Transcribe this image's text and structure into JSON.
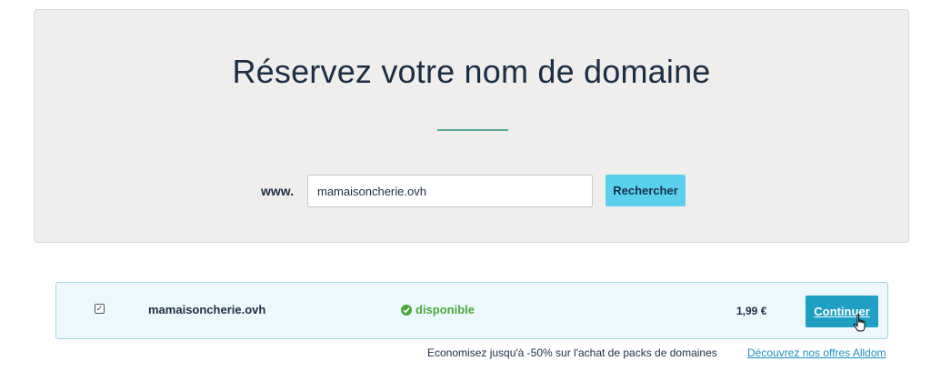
{
  "hero": {
    "title": "Réservez votre nom de domaine",
    "www_label": "www.",
    "search_value": "mamaisoncherie.ovh",
    "search_button": "Rechercher"
  },
  "result": {
    "checkbox_checked": true,
    "domain": "mamaisoncherie.ovh",
    "status": "disponible",
    "status_icon": "check-circle-icon",
    "price": "1,99 €",
    "continue_label": "Continuer"
  },
  "promo": {
    "text": "Economisez jusqu'à -50% sur l'achat de packs de domaines",
    "link": "Découvrez nos offres Alldom"
  },
  "colors": {
    "accent": "#5bd0ee",
    "primary_button": "#1e9fc3",
    "success": "#4aa83a",
    "hero_bg": "#efeeec"
  }
}
